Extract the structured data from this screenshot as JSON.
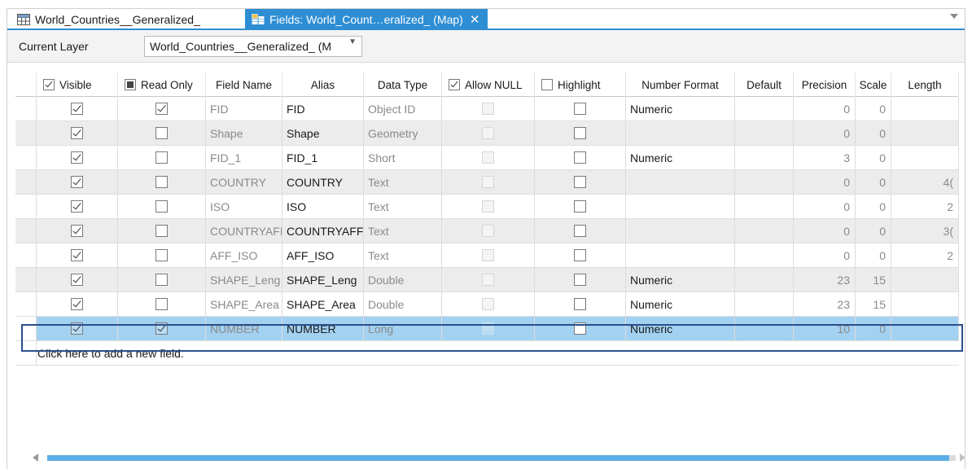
{
  "tabs": [
    {
      "label": "World_Countries__Generalized_",
      "active": false,
      "icon": "table-icon"
    },
    {
      "label": "Fields:  World_Count…eralized_ (Map)",
      "active": true,
      "icon": "fields-icon"
    }
  ],
  "layer": {
    "label": "Current Layer",
    "value": "World_Countries__Generalized_ (M"
  },
  "columns": [
    "Visible",
    "Read Only",
    "Field Name",
    "Alias",
    "Data Type",
    "Allow NULL",
    "Highlight",
    "Number Format",
    "Default",
    "Precision",
    "Scale",
    "Length"
  ],
  "rows": [
    {
      "visible": true,
      "readonly": true,
      "name": "FID",
      "alias": "FID",
      "type": "Object ID",
      "allownull": false,
      "highlight": false,
      "format": "Numeric",
      "default": "",
      "precision": "0",
      "scale": "0",
      "length": ""
    },
    {
      "visible": true,
      "readonly": false,
      "name": "Shape",
      "alias": "Shape",
      "type": "Geometry",
      "allownull": false,
      "highlight": false,
      "format": "",
      "default": "",
      "precision": "0",
      "scale": "0",
      "length": ""
    },
    {
      "visible": true,
      "readonly": false,
      "name": "FID_1",
      "alias": "FID_1",
      "type": "Short",
      "allownull": false,
      "highlight": false,
      "format": "Numeric",
      "default": "",
      "precision": "3",
      "scale": "0",
      "length": ""
    },
    {
      "visible": true,
      "readonly": false,
      "name": "COUNTRY",
      "alias": "COUNTRY",
      "type": "Text",
      "allownull": false,
      "highlight": false,
      "format": "",
      "default": "",
      "precision": "0",
      "scale": "0",
      "length": "4("
    },
    {
      "visible": true,
      "readonly": false,
      "name": "ISO",
      "alias": "ISO",
      "type": "Text",
      "allownull": false,
      "highlight": false,
      "format": "",
      "default": "",
      "precision": "0",
      "scale": "0",
      "length": "2"
    },
    {
      "visible": true,
      "readonly": false,
      "name": "COUNTRYAFF",
      "alias": "COUNTRYAFF",
      "type": "Text",
      "allownull": false,
      "highlight": false,
      "format": "",
      "default": "",
      "precision": "0",
      "scale": "0",
      "length": "3("
    },
    {
      "visible": true,
      "readonly": false,
      "name": "AFF_ISO",
      "alias": "AFF_ISO",
      "type": "Text",
      "allownull": false,
      "highlight": false,
      "format": "",
      "default": "",
      "precision": "0",
      "scale": "0",
      "length": "2"
    },
    {
      "visible": true,
      "readonly": false,
      "name": "SHAPE_Leng",
      "alias": "SHAPE_Leng",
      "type": "Double",
      "allownull": false,
      "highlight": false,
      "format": "Numeric",
      "default": "",
      "precision": "23",
      "scale": "15",
      "length": ""
    },
    {
      "visible": true,
      "readonly": false,
      "name": "SHAPE_Area",
      "alias": "SHAPE_Area",
      "type": "Double",
      "allownull": false,
      "highlight": false,
      "format": "Numeric",
      "default": "",
      "precision": "23",
      "scale": "15",
      "length": ""
    },
    {
      "visible": true,
      "readonly": true,
      "name": "NUMBER",
      "alias": "NUMBER",
      "type": "Long",
      "allownull": false,
      "highlight": false,
      "format": "Numeric",
      "default": "",
      "precision": "10",
      "scale": "0",
      "length": "",
      "selected": true
    }
  ],
  "add_field_text": "Click here to add a new field.",
  "colors": {
    "accent": "#2d8ed4",
    "selected_row": "#a3d1f1",
    "selection_border": "#2b4f8a"
  }
}
